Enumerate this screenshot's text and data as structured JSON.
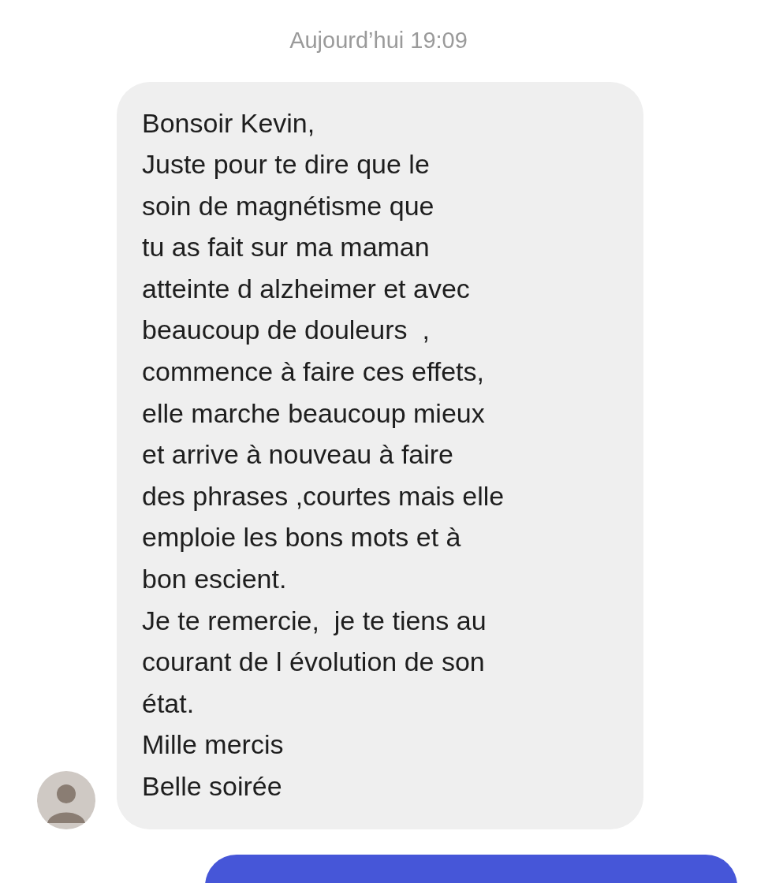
{
  "timestamp": "Aujourd’hui 19:09",
  "messages": [
    {
      "kind": "received",
      "text": "Bonsoir Kevin,\nJuste pour te dire que le\nsoin de magnétisme que\ntu as fait sur ma maman\natteinte d alzheimer et avec\nbeaucoup de douleurs  ,\ncommence à faire ces effets,\nelle marche beaucoup mieux\net arrive à nouveau à faire\ndes phrases ,courtes mais elle\nemploie les bons mots et à\nbon escient.\nJe te remercie,  je te tiens au\ncourant de l évolution de son\nétat.\nMille mercis\nBelle soirée"
    },
    {
      "kind": "sent"
    }
  ]
}
